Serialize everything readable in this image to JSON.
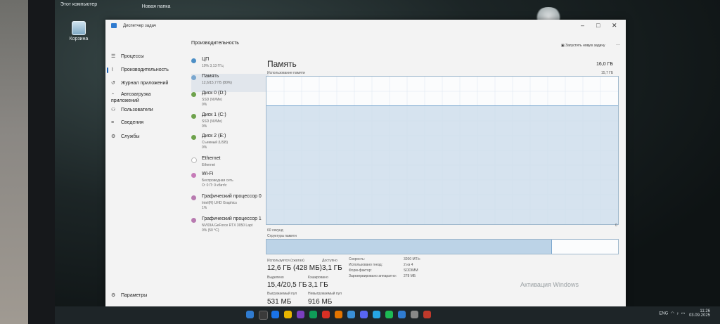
{
  "desktop": {
    "icons": [
      {
        "label": "Этот компьютер",
        "icon": "computer-icon"
      },
      {
        "label": "Новая папка",
        "icon": "folder-icon"
      },
      {
        "label": "Корзина",
        "icon": "recycle-bin-icon"
      }
    ]
  },
  "window": {
    "title": "Диспетчер задач",
    "controls": {
      "minimize": "–",
      "maximize": "□",
      "close": "✕"
    }
  },
  "sidebar": {
    "items": [
      {
        "label": "Процессы",
        "icon": "processes-icon",
        "active": false
      },
      {
        "label": "Производительность",
        "icon": "performance-icon",
        "active": true
      },
      {
        "label": "Журнал приложений",
        "icon": "history-icon",
        "active": false
      },
      {
        "label": "Автозагрузка приложений",
        "icon": "startup-icon",
        "active": false
      },
      {
        "label": "Пользователи",
        "icon": "users-icon",
        "active": false
      },
      {
        "label": "Сведения",
        "icon": "details-icon",
        "active": false
      },
      {
        "label": "Службы",
        "icon": "services-icon",
        "active": false
      }
    ],
    "settings_label": "Параметры"
  },
  "performance": {
    "heading": "Производительность",
    "run_task_label": "Запустить новую задачу",
    "more_label": "···",
    "resources": [
      {
        "name": "ЦП",
        "sub1": "10% 3,13 ГГц",
        "sub2": "",
        "color": "#4d8fc6"
      },
      {
        "name": "Память",
        "sub1": "12,6/15,7 ГБ (80%)",
        "sub2": "",
        "color": "#7aa7cf"
      },
      {
        "name": "Диск 0 (D:)",
        "sub1": "SSD (NVMe)",
        "sub2": "0%",
        "color": "#6ea24c"
      },
      {
        "name": "Диск 1 (C:)",
        "sub1": "SSD (NVMe)",
        "sub2": "0%",
        "color": "#6ea24c"
      },
      {
        "name": "Диск 2 (E:)",
        "sub1": "Съемный (USB)",
        "sub2": "0%",
        "color": "#6ea24c"
      },
      {
        "name": "Ethernet",
        "sub1": "Ethernet",
        "sub2": "",
        "color": "#ffffff"
      },
      {
        "name": "Wi-Fi",
        "sub1": "Беспроводная сеть",
        "sub2": "О: 0 П: 0 кбит/с",
        "color": "#c67bb8"
      },
      {
        "name": "Графический процессор 0",
        "sub1": "Intel(R) UHD Graphics",
        "sub2": "1%",
        "color": "#b87ab0"
      },
      {
        "name": "Графический процессор 1",
        "sub1": "NVIDIA GeForce RTX 3050 Lapt",
        "sub2": "0% (50 °C)",
        "color": "#b87ab0"
      }
    ]
  },
  "memory": {
    "title": "Память",
    "total": "16,0 ГБ",
    "usage_label": "Использование памяти",
    "usage_max": "15,7 ГБ",
    "time_label": "60 секунд",
    "min_label": "0",
    "composition_label": "Структура памяти",
    "composition_used_fraction": 0.81,
    "stats": {
      "in_use_label": "Используется (сжатая)",
      "in_use_value": "12,6 ГБ (428 МБ)",
      "available_label": "Доступно",
      "available_value": "3,1 ГБ",
      "committed_label": "Выделено",
      "committed_value": "15,4/20,5 ГБ",
      "cached_label": "Кэшировано",
      "cached_value": "3,1 ГБ",
      "paged_label": "Выгружаемый пул",
      "paged_value": "531 МБ",
      "nonpaged_label": "Невыгружаемый пул",
      "nonpaged_value": "916 МБ"
    },
    "details": [
      {
        "label": "Скорость:",
        "value": "3200 МТ/с"
      },
      {
        "label": "Использовано гнезд:",
        "value": "2 из 4"
      },
      {
        "label": "Форм-фактор:",
        "value": "SODIMM"
      },
      {
        "label": "Зарезервировано аппаратно:",
        "value": "278 МБ"
      }
    ]
  },
  "chart_data": {
    "type": "area",
    "ylim": [
      0,
      15.7
    ],
    "ylabel": "Использование памяти",
    "xlabel": "60 секунд",
    "series": [
      {
        "values": [
          12.6,
          12.6,
          12.6,
          12.6,
          12.6,
          12.6,
          12.6,
          12.6,
          12.6,
          12.6,
          12.6,
          12.6,
          12.6,
          12.6,
          12.6,
          12.6,
          12.6,
          12.6,
          12.6,
          12.6
        ]
      }
    ],
    "grid": true,
    "color": "#7aa7cf"
  },
  "watermark": "Активация Windows",
  "tray": {
    "lang": "ENG",
    "time": "11:26",
    "date": "03.09.2025"
  }
}
